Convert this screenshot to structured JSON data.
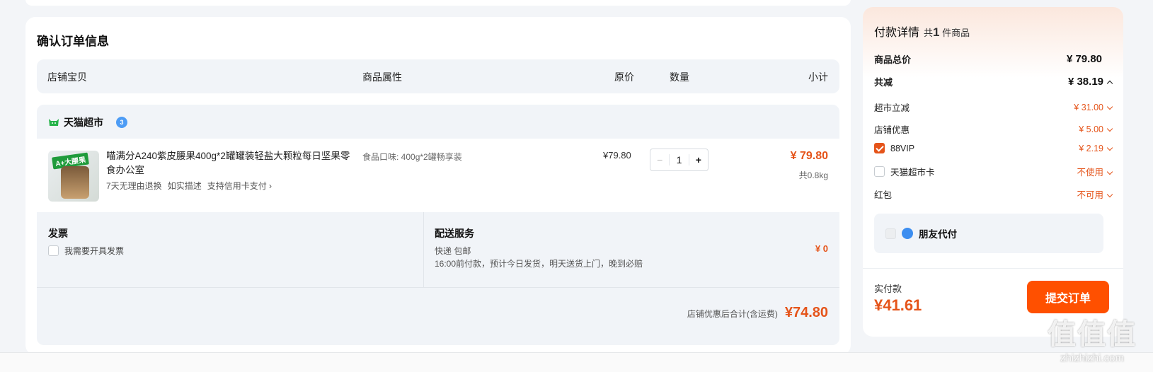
{
  "order": {
    "title": "确认订单信息",
    "columns": [
      "店铺宝贝",
      "商品属性",
      "原价",
      "数量",
      "小计"
    ],
    "shop": {
      "name": "天猫超市",
      "badge": "3",
      "item": {
        "name": "喵满分A240紫皮腰果400g*2罐罐装轻盐大颗粒每日坚果零食办公室",
        "image_label": "A+大腰果",
        "tags": [
          "7天无理由退换",
          "如实描述",
          "支持信用卡支付 ›"
        ],
        "attribute": "食品口味: 400g*2罐畅享装",
        "original_price": "¥79.80",
        "quantity": "1",
        "subtotal": "¥ 79.80",
        "weight": "共0.8kg"
      },
      "invoice": {
        "title": "发票",
        "option": "我需要开具发票"
      },
      "delivery": {
        "title": "配送服务",
        "method": "快递 包邮",
        "note": "16:00前付款，预计今日发货，明天送货上门，晚到必赔",
        "fee": "¥ 0"
      },
      "total_label": "店铺优惠后合计(含运费)",
      "total_value": "¥74.80"
    }
  },
  "payment": {
    "title": "付款详情",
    "count_prefix": "共",
    "count": "1",
    "count_suffix": "件商品",
    "goods_total_label": "商品总价",
    "goods_total": "¥ 79.80",
    "discount_label": "共减",
    "discount": "¥ 38.19",
    "rows": [
      {
        "label": "超市立减",
        "value": "¥ 31.00"
      },
      {
        "label": "店铺优惠",
        "value": "¥ 5.00"
      },
      {
        "label": "88VIP",
        "value": "¥ 2.19"
      },
      {
        "label": "天猫超市卡",
        "value": "不使用"
      },
      {
        "label": "红包",
        "value": "不可用"
      }
    ],
    "friend_pay": "朋友代付",
    "pay_label": "实付款",
    "pay_value": "¥41.61",
    "submit": "提交订单"
  },
  "watermark": {
    "glyphs": "值值值",
    "site": "zhizhizhi.com"
  },
  "colors": {
    "accent": "#ff5000",
    "price": "#e5541a",
    "panel": "#f1f4f8"
  }
}
